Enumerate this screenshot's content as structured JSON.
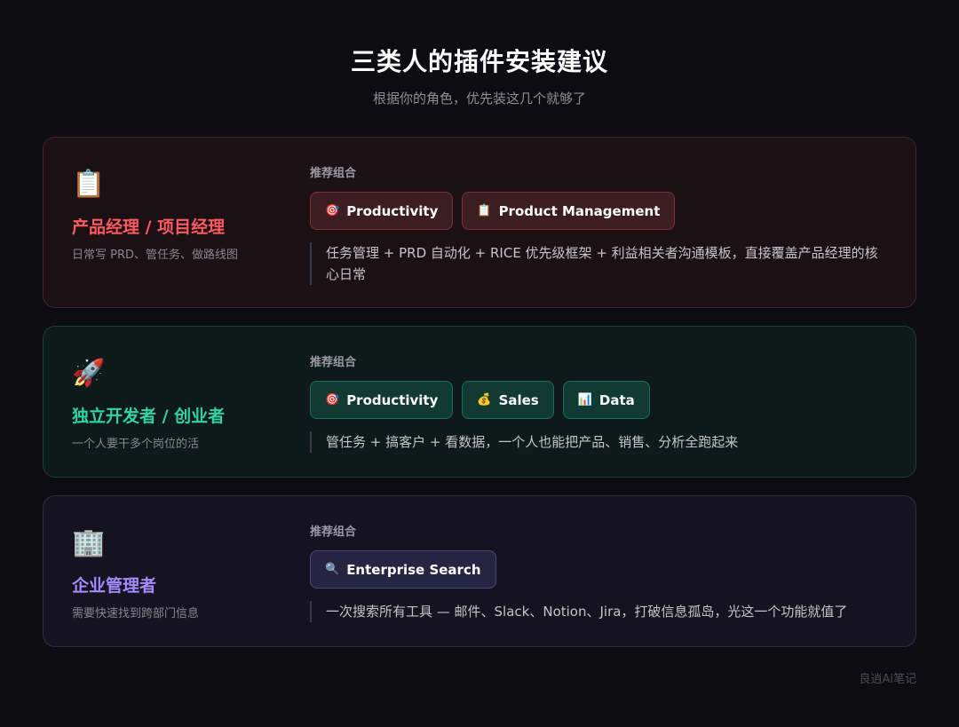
{
  "header": {
    "title": "三类人的插件安装建议",
    "subtitle": "根据你的角色，优先装这几个就够了"
  },
  "cards": [
    {
      "emoji": "📋",
      "role": "产品经理 / 项目经理",
      "desc": "日常写 PRD、管任务、做路线图",
      "combo_label": "推荐组合",
      "chips": [
        {
          "icon": "🎯",
          "label": "Productivity"
        },
        {
          "icon": "📋",
          "label": "Product Management"
        }
      ],
      "note": "任务管理 + PRD 自动化 + RICE 优先级框架 + 利益相关者沟通模板，直接覆盖产品经理的核心日常"
    },
    {
      "emoji": "🚀",
      "role": "独立开发者 / 创业者",
      "desc": "一个人要干多个岗位的活",
      "combo_label": "推荐组合",
      "chips": [
        {
          "icon": "🎯",
          "label": "Productivity"
        },
        {
          "icon": "💰",
          "label": "Sales"
        },
        {
          "icon": "📊",
          "label": "Data"
        }
      ],
      "note": "管任务 + 搞客户 + 看数据，一个人也能把产品、销售、分析全跑起来"
    },
    {
      "emoji": "🏢",
      "role": "企业管理者",
      "desc": "需要快速找到跨部门信息",
      "combo_label": "推荐组合",
      "chips": [
        {
          "icon": "🔍",
          "label": "Enterprise Search"
        }
      ],
      "note": "一次搜索所有工具 — 邮件、Slack、Notion、Jira，打破信息孤岛，光这一个功能就值了"
    }
  ],
  "watermark": "良逍Ai笔记",
  "colors": {
    "background": "#0c0c11",
    "pm_accent": "#ff5a5f",
    "dev_accent": "#2fd3a5",
    "exec_accent": "#a58bff"
  }
}
